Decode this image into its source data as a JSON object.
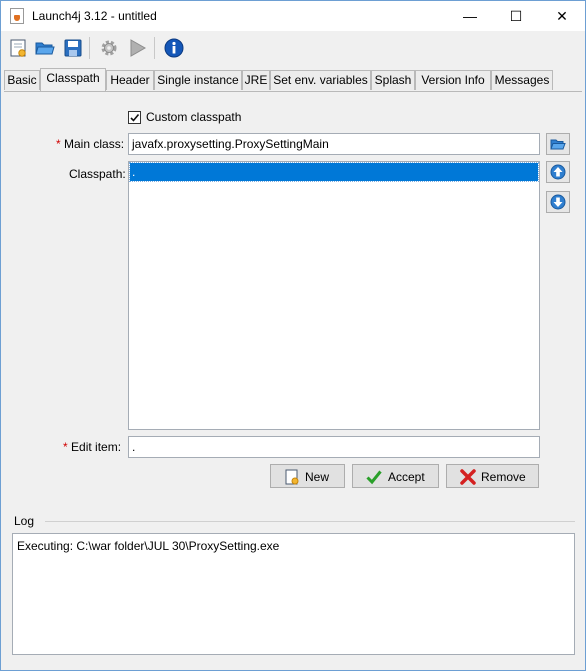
{
  "window": {
    "title": "Launch4j 3.12 - untitled",
    "controls": {
      "minimize": "—",
      "maximize": "☐",
      "close": "✕"
    }
  },
  "toolbar": {
    "buttons": [
      {
        "name": "new-config",
        "icon": "new-file-icon"
      },
      {
        "name": "open-config",
        "icon": "folder-open-icon"
      },
      {
        "name": "save-config",
        "icon": "save-icon"
      },
      {
        "name": "build-wrapper",
        "icon": "gear-icon"
      },
      {
        "name": "test-wrapper",
        "icon": "play-icon"
      },
      {
        "name": "about",
        "icon": "info-icon"
      }
    ]
  },
  "tabs": [
    {
      "label": "Basic"
    },
    {
      "label": "Classpath"
    },
    {
      "label": "Header"
    },
    {
      "label": "Single instance"
    },
    {
      "label": "JRE"
    },
    {
      "label": "Set env. variables"
    },
    {
      "label": "Splash"
    },
    {
      "label": "Version Info"
    },
    {
      "label": "Messages"
    }
  ],
  "active_tab": "Classpath",
  "classpath": {
    "custom_classpath_label": "Custom classpath",
    "custom_classpath_checked": true,
    "required_marker": "*",
    "main_class_label": "Main class:",
    "main_class_value": "javafx.proxysetting.ProxySettingMain",
    "classpath_label": "Classpath:",
    "classpath_items": [
      "."
    ],
    "edit_item_label": "Edit item:",
    "edit_item_value": ".",
    "buttons": {
      "new": "New",
      "accept": "Accept",
      "remove": "Remove"
    }
  },
  "log": {
    "title": "Log",
    "text": "Executing: C:\\war folder\\JUL 30\\ProxySetting.exe"
  },
  "colors": {
    "selection": "#0078d7",
    "required": "#d00000",
    "accent": "#1e6fd9"
  }
}
